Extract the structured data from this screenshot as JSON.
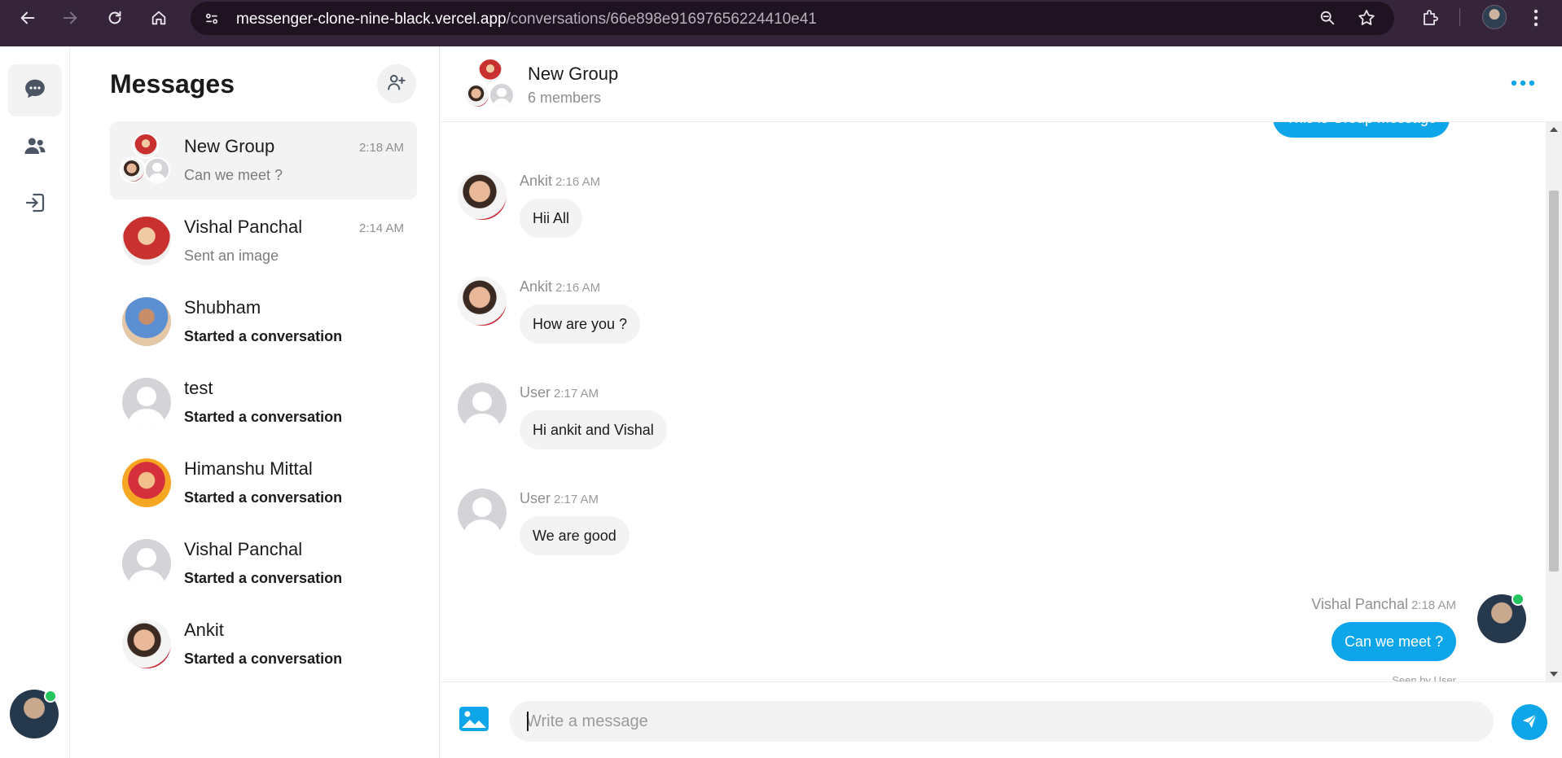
{
  "browser": {
    "url_host": "messenger-clone-nine-black.vercel.app",
    "url_path": "/conversations/66e898e91697656224410e41"
  },
  "sidebar": {
    "title": "Messages",
    "conversations": [
      {
        "name": "New Group",
        "preview": "Can we meet ?",
        "time": "2:18 AM",
        "avatar": "group",
        "preview_bold": false,
        "active": true
      },
      {
        "name": "Vishal Panchal",
        "preview": "Sent an image",
        "time": "2:14 AM",
        "avatar": "photo-red",
        "preview_bold": false,
        "active": false
      },
      {
        "name": "Shubham",
        "preview": "Started a conversation",
        "time": "",
        "avatar": "photo-blue",
        "preview_bold": true,
        "active": false
      },
      {
        "name": "test",
        "preview": "Started a conversation",
        "time": "",
        "avatar": "default",
        "preview_bold": true,
        "active": false
      },
      {
        "name": "Himanshu Mittal",
        "preview": "Started a conversation",
        "time": "",
        "avatar": "photo-festive",
        "preview_bold": true,
        "active": false
      },
      {
        "name": "Vishal Panchal",
        "preview": "Started a conversation",
        "time": "",
        "avatar": "default",
        "preview_bold": true,
        "active": false
      },
      {
        "name": "Ankit",
        "preview": "Started a conversation",
        "time": "",
        "avatar": "photo-ankit",
        "preview_bold": true,
        "active": false
      }
    ]
  },
  "chat": {
    "header": {
      "name": "New Group",
      "members": "6 members"
    },
    "top_partial_message": "This is Group Message",
    "messages": [
      {
        "sender": "Ankit",
        "time": "2:16 AM",
        "text": "Hii All",
        "direction": "in",
        "avatar": "photo-ankit"
      },
      {
        "sender": "Ankit",
        "time": "2:16 AM",
        "text": "How are you ?",
        "direction": "in",
        "avatar": "photo-ankit"
      },
      {
        "sender": "User",
        "time": "2:17 AM",
        "text": "Hi ankit and Vishal",
        "direction": "in",
        "avatar": "default"
      },
      {
        "sender": "User",
        "time": "2:17 AM",
        "text": "We are good",
        "direction": "in",
        "avatar": "default"
      },
      {
        "sender": "Vishal Panchal",
        "time": "2:18 AM",
        "text": "Can we meet ?",
        "direction": "out",
        "avatar": "photo-self"
      }
    ],
    "seen_by": "Seen by User",
    "composer": {
      "placeholder": "Write a message"
    }
  },
  "colors": {
    "accent": "#0ea5e9",
    "online": "#22c55e",
    "chrome": "#35243a"
  }
}
